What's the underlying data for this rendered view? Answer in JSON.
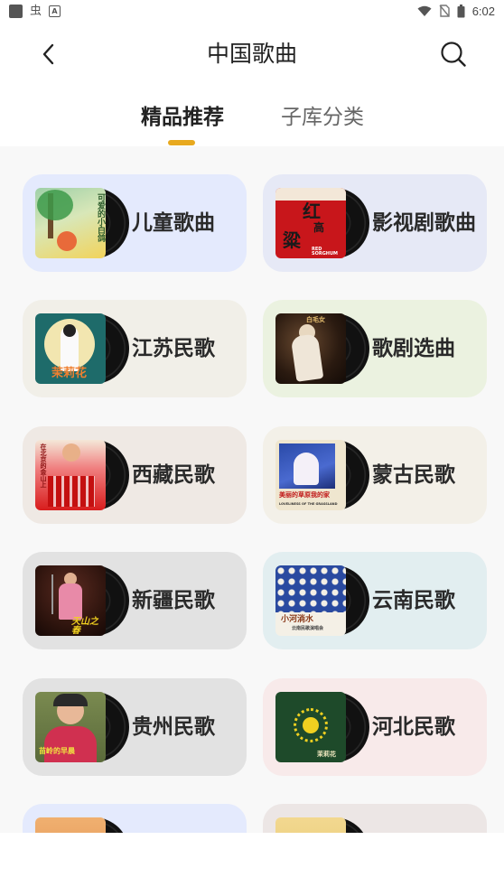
{
  "status_bar": {
    "app_glyph": "虫",
    "app_badge": "A",
    "time": "6:02"
  },
  "header": {
    "title": "中国歌曲"
  },
  "tabs": [
    {
      "label": "精品推荐",
      "active": true
    },
    {
      "label": "子库分类",
      "active": false
    }
  ],
  "colors": {
    "accent": "#e8a91e"
  },
  "categories": [
    {
      "label": "儿童歌曲",
      "bg": "#e4eafd"
    },
    {
      "label": "影视剧歌曲",
      "bg": "#e6e9f6"
    },
    {
      "label": "江苏民歌",
      "bg": "#f1efe8"
    },
    {
      "label": "歌剧选曲",
      "bg": "#ebf2e0"
    },
    {
      "label": "西藏民歌",
      "bg": "#efe9e4"
    },
    {
      "label": "蒙古民歌",
      "bg": "#f3f0e8"
    },
    {
      "label": "新疆民歌",
      "bg": "#e2e2e2"
    },
    {
      "label": "云南民歌",
      "bg": "#e2eef0"
    },
    {
      "label": "贵州民歌",
      "bg": "#e2e2e2"
    },
    {
      "label": "河北民歌",
      "bg": "#f8eaea"
    },
    {
      "label": "",
      "bg": "#e4eafd"
    },
    {
      "label": "",
      "bg": "#ece6e5"
    }
  ],
  "album_art": {
    "children": [
      "可爱的小白鸽"
    ],
    "film": [
      "红",
      "高",
      "粱",
      "RED SORGHUM"
    ],
    "jiangsu": [
      "茉莉花"
    ],
    "opera": [
      "白毛女"
    ],
    "tibet": [
      "在北京的金山上"
    ],
    "mongolia": [
      "美丽的草原我的家",
      "LOVELINESS OF THE GRASSLAND"
    ],
    "xinjiang": [
      "天山之春"
    ],
    "yunnan": [
      "小河淌水",
      "云南民歌演唱会"
    ],
    "guizhou": [
      "苗岭的早晨"
    ],
    "hebei": [
      "茉莉花"
    ]
  }
}
